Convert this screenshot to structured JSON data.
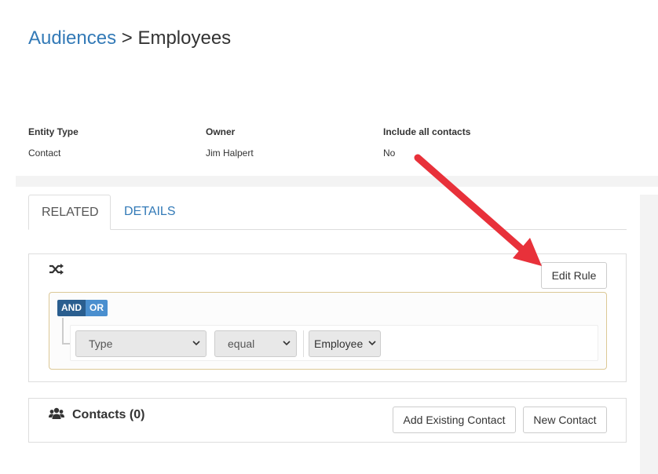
{
  "breadcrumb": {
    "parent": "Audiences",
    "separator": ">",
    "current": "Employees"
  },
  "info": {
    "entity_type": {
      "label": "Entity Type",
      "value": "Contact"
    },
    "owner": {
      "label": "Owner",
      "value": "Jim Halpert"
    },
    "include_all": {
      "label": "Include all contacts",
      "value": "No"
    }
  },
  "tabs": [
    {
      "label": "RELATED",
      "active": true
    },
    {
      "label": "DETAILS",
      "active": false
    }
  ],
  "rule_panel": {
    "icon": "shuffle-icon",
    "edit_button": "Edit Rule",
    "logic": {
      "and": "AND",
      "or": "OR",
      "selected": "AND"
    },
    "rule": {
      "field": "Type",
      "operator": "equal",
      "value": "Employee"
    }
  },
  "contacts_panel": {
    "icon": "people-icon",
    "title": "Contacts (0)",
    "add_existing_button": "Add Existing Contact",
    "new_contact_button": "New Contact"
  },
  "annotation": {
    "arrow_color": "#e8313a"
  },
  "colors": {
    "link": "#337ab7",
    "and_active": "#2a5e8f",
    "or": "#4a8fcf",
    "rule_border": "#dcc896"
  }
}
